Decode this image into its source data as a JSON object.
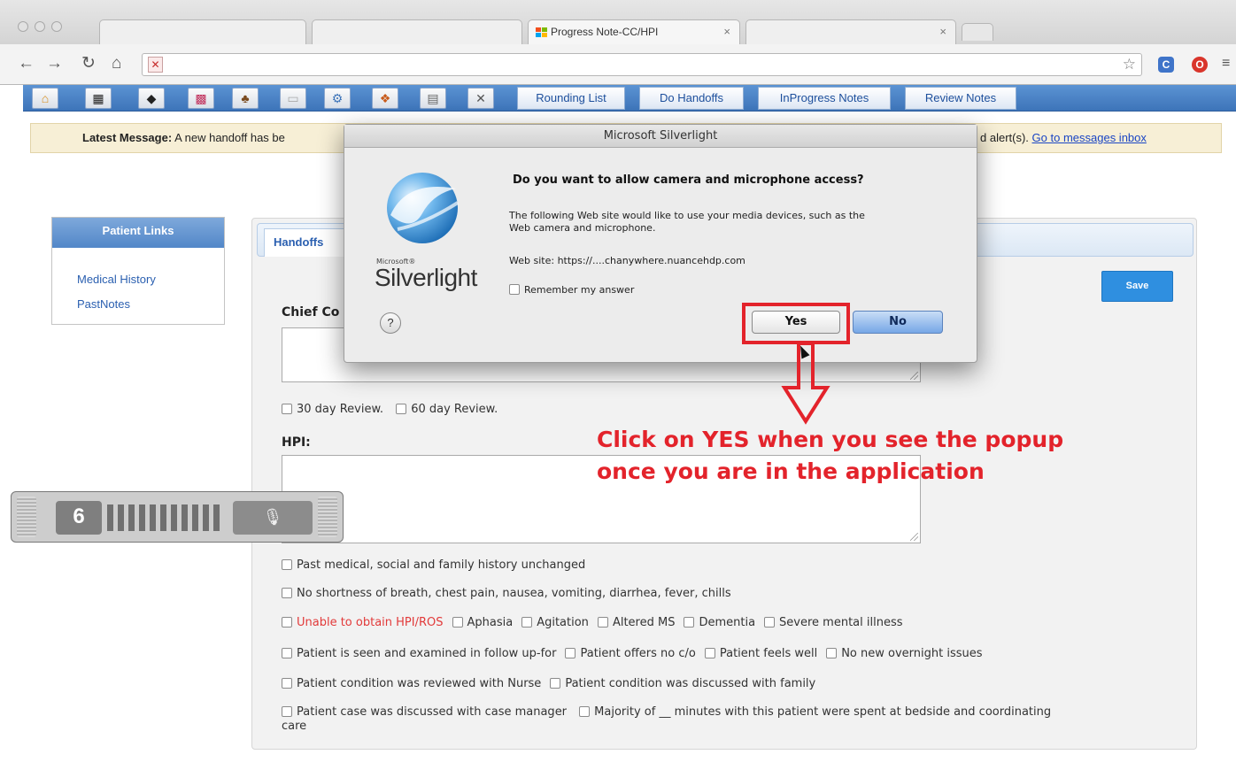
{
  "browser": {
    "active_tab_title": "Progress Note-CC/HPI",
    "tab_close_glyph": "×",
    "new_tab": ""
  },
  "toolbar": {
    "icons": [
      "home-icon",
      "calculator-icon",
      "chart-icon",
      "calendar-icon",
      "users-icon",
      "document-icon",
      "settings-icon",
      "group-icon",
      "clipboard-icon",
      "tools-icon"
    ],
    "nav_buttons": [
      "Rounding List",
      "Do Handoffs",
      "InProgress Notes",
      "Review Notes"
    ]
  },
  "banner": {
    "label": "Latest Message:",
    "text_start": "A new handoff has be",
    "text_end": "d alert(s).",
    "link": "Go to messages inbox"
  },
  "patient_links": {
    "header": "Patient Links",
    "items": [
      "Medical History",
      "PastNotes"
    ]
  },
  "form": {
    "tab_label": "Handoffs",
    "save_label": "Save",
    "chief_complaint_label": "Chief Co",
    "review_30": "30 day Review.",
    "review_60": "60 day Review.",
    "hpi_label": "HPI:",
    "checkbox_rows": [
      [
        {
          "label": "Past medical, social and family history unchanged",
          "red": false
        }
      ],
      [
        {
          "label": "No shortness of breath, chest pain, nausea, vomiting, diarrhea, fever, chills",
          "red": false
        }
      ],
      [
        {
          "label": "Unable to obtain HPI/ROS",
          "red": true
        },
        {
          "label": "Aphasia",
          "red": false
        },
        {
          "label": "Agitation",
          "red": false
        },
        {
          "label": "Altered MS",
          "red": false
        },
        {
          "label": "Dementia",
          "red": false
        },
        {
          "label": "Severe mental illness",
          "red": false
        }
      ],
      [
        {
          "label": "Patient is seen and examined in follow up-for",
          "red": false
        },
        {
          "label": "Patient offers no c/o",
          "red": false
        },
        {
          "label": "Patient feels well",
          "red": false
        },
        {
          "label": "No new overnight issues",
          "red": false
        }
      ],
      [
        {
          "label": "Patient condition was reviewed with Nurse",
          "red": false
        },
        {
          "label": "Patient condition was discussed with family",
          "red": false
        }
      ]
    ],
    "last_row_a": "Patient case was discussed with case manager",
    "last_row_b": "Majority of __ minutes with this patient were spent at bedside and coordinating",
    "last_row_wrap": "care"
  },
  "dialog": {
    "title": "Microsoft Silverlight",
    "question": "Do you want to allow camera and microphone access?",
    "description_line1": "The following Web site would like to use your media devices, such as the",
    "description_line2": "Web camera and microphone.",
    "website_label": "Web site:",
    "website_value": "https://....chanywhere.nuancehdp.com",
    "remember_label": "Remember my answer",
    "help": "?",
    "yes_label": "Yes",
    "no_label": "No",
    "logo_small": "Microsoft®",
    "logo_word": "Silverlight"
  },
  "annotation": {
    "line1": "Click on YES when you see the popup",
    "line2": "once you are in the application",
    "color": "#e3232b"
  },
  "colors": {
    "toolbar_blue": "#4a82c6",
    "save_blue": "#2f8fe0",
    "banner_bg": "#f7efd6",
    "link_blue": "#1a45c4"
  }
}
